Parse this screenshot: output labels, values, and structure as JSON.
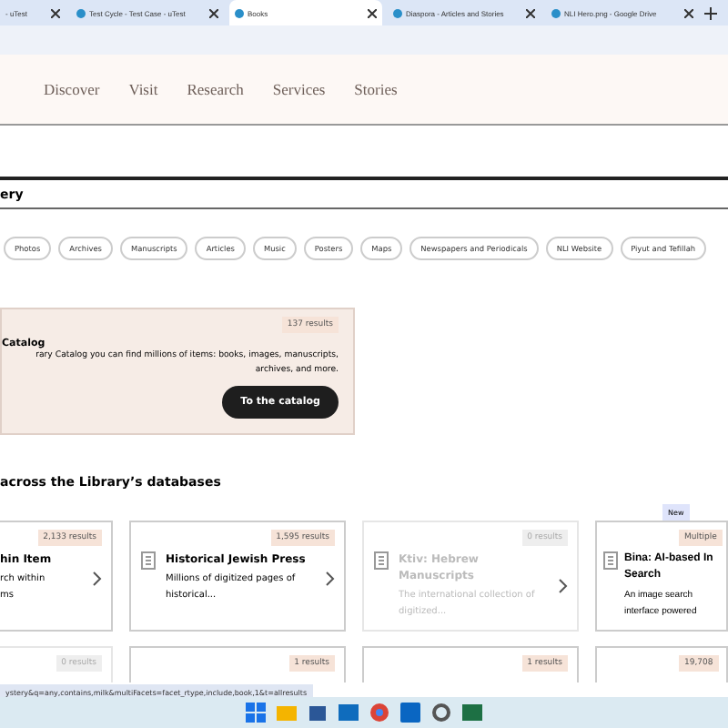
{
  "browser_tabs": [
    {
      "title": "- uTest",
      "selected": false
    },
    {
      "title": "Test Cycle - Test Case - uTest",
      "selected": false
    },
    {
      "title": "Books",
      "selected": true
    },
    {
      "title": "Diaspora - Articles and Stories",
      "selected": false
    },
    {
      "title": "NLI Hero.png - Google Drive",
      "selected": false
    }
  ],
  "nav": [
    "Discover",
    "Visit",
    "Research",
    "Services",
    "Stories"
  ],
  "query": "ery",
  "filters": [
    "Photos",
    "Archives",
    "Manuscripts",
    "Articles",
    "Music",
    "Posters",
    "Maps",
    "Newspapers and Periodicals",
    "NLI Website",
    "Piyut and Tefillah"
  ],
  "catalog": {
    "count": "137 results",
    "title": "Catalog",
    "text": "rary Catalog you can find millions of items: books, images, manuscripts, archives, and more.",
    "button": "To the catalog"
  },
  "section_title": "across the Library’s databases",
  "databases": [
    {
      "count": "2,133 results",
      "title": "hin Item",
      "text": "rch within\nms",
      "disabled": false
    },
    {
      "count": "1,595 results",
      "title": "Historical Jewish Press",
      "text": "Millions of digitized pages of historical...",
      "disabled": false
    },
    {
      "count": "0 results",
      "title": "Ktiv: Hebrew Manuscripts",
      "text": "The international collection of digitized...",
      "disabled": true
    },
    {
      "count": "Multiple",
      "badge": "New",
      "title": "Bina: AI-based In\nSearch",
      "text": "An image search\ninterface powered",
      "disabled": false
    }
  ],
  "more_counts": [
    {
      "count": "0 results",
      "disabled": true
    },
    {
      "count": "1 results",
      "disabled": false
    },
    {
      "count": "1 results",
      "disabled": false
    },
    {
      "count": "19,708",
      "disabled": false
    }
  ],
  "status_url": "ystery&q=any,contains,milk&multiFacets=facet_rtype,include,book,1&t=allresults"
}
